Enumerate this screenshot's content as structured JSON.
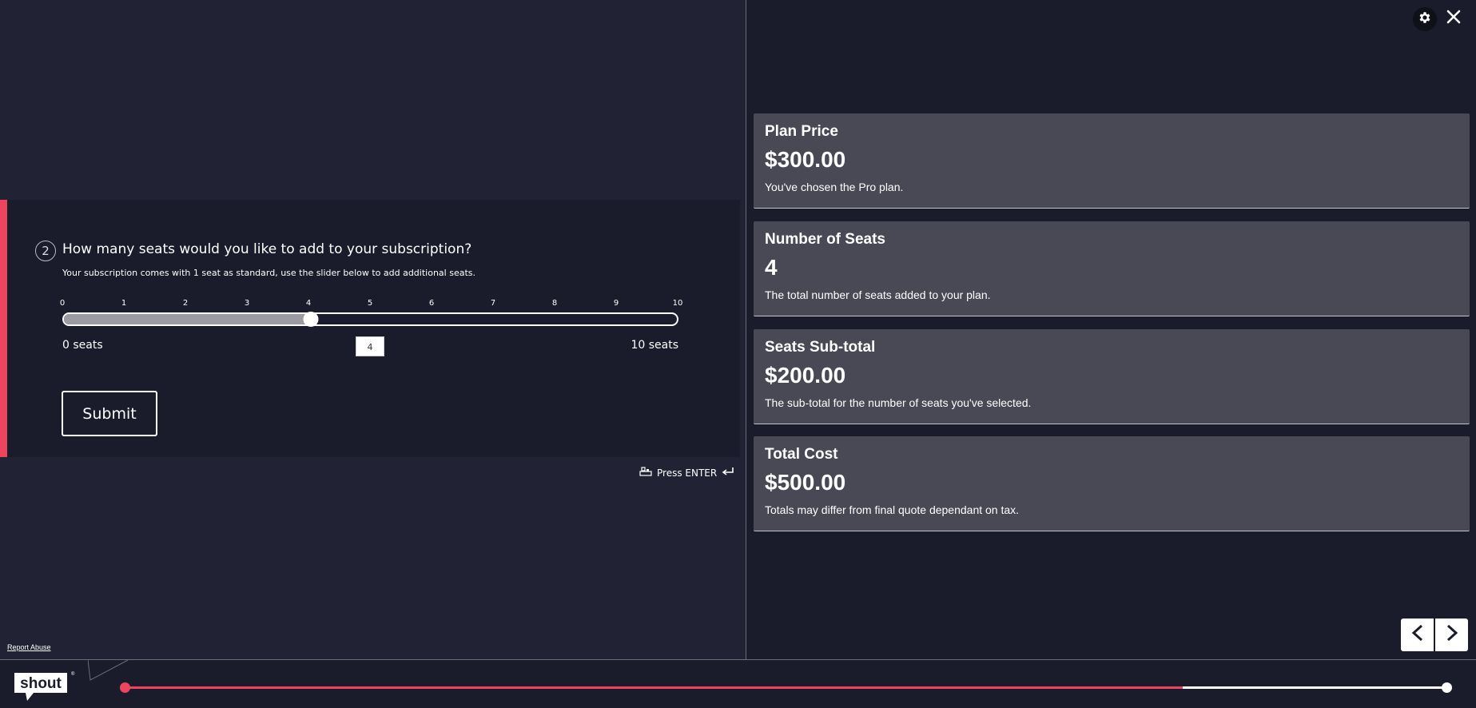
{
  "question": {
    "number": "2",
    "title": "How many seats would you like to add to your subscription?",
    "subtitle": "Your subscription comes with 1 seat as standard, use the slider below to add additional seats.",
    "ticks": [
      "0",
      "1",
      "2",
      "3",
      "4",
      "5",
      "6",
      "7",
      "8",
      "9",
      "10"
    ],
    "slider": {
      "min": 0,
      "max": 10,
      "value": 4
    },
    "min_label": "0 seats",
    "max_label": "10 seats",
    "value_display": "4",
    "submit_label": "Submit",
    "press_enter": "Press ENTER"
  },
  "summary": {
    "cards": [
      {
        "heading": "Plan Price",
        "value": "$300.00",
        "desc": "You've chosen the Pro plan."
      },
      {
        "heading": "Number of Seats",
        "value": "4",
        "desc": "The total number of seats added to your plan."
      },
      {
        "heading": "Seats Sub-total",
        "value": "$200.00",
        "desc": "The sub-total for the number of seats you've selected."
      },
      {
        "heading": "Total Cost",
        "value": "$500.00",
        "desc": "Totals may differ from final quote dependant on tax."
      }
    ]
  },
  "footer": {
    "report_abuse": "Report Abuse",
    "logo_text": "shout",
    "progress": 0.8
  },
  "icons": {
    "settings": "gear-icon",
    "close": "close-icon",
    "prev": "chevron-left-icon",
    "next": "chevron-right-icon",
    "keyboard": "keyboard-icon",
    "enter": "enter-key-icon"
  },
  "colors": {
    "accent": "#ee4460",
    "background": "#1c1d2c",
    "card": "#484954"
  }
}
